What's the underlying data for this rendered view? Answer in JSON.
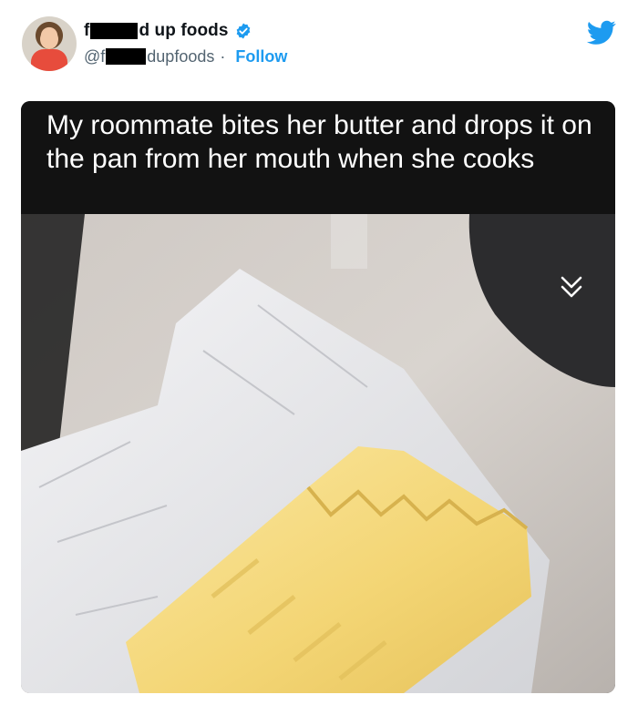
{
  "tweet": {
    "display_name_start": "f",
    "display_name_end": "d up foods",
    "handle_start": "@f",
    "handle_end": "dupfoods",
    "separator": "·",
    "follow_label": "Follow",
    "verified": true,
    "platform_icon": "twitter-bird-icon",
    "caption": "My roommate bites her butter and drops it on the pan from her mouth when she cooks"
  },
  "colors": {
    "accent": "#1d9bf0",
    "name_text": "#0f1419",
    "handle_text": "#536471",
    "caption_bg": "#121212",
    "caption_text": "#ffffff"
  },
  "icons": {
    "verified": "verified-badge-icon",
    "expand": "double-chevron-down-icon"
  }
}
